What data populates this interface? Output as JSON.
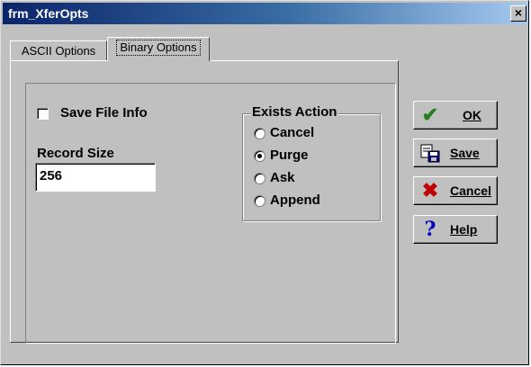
{
  "window": {
    "title": "frm_XferOpts",
    "close_glyph": "×"
  },
  "tabs": [
    {
      "label": "ASCII Options"
    },
    {
      "label": "Binary Options",
      "selected": true
    }
  ],
  "binary_options": {
    "save_file_info": {
      "label": "Save File Info",
      "checked": false
    },
    "record_size": {
      "label": "Record Size",
      "value": "256"
    },
    "exists_action": {
      "title": "Exists Action",
      "options": [
        {
          "label": "Cancel",
          "selected": false
        },
        {
          "label": "Purge",
          "selected": true
        },
        {
          "label": "Ask",
          "selected": false
        },
        {
          "label": "Append",
          "selected": false
        }
      ]
    }
  },
  "buttons": {
    "ok": {
      "label": "OK",
      "icon": "checkmark-icon"
    },
    "save": {
      "label": "Save",
      "icon": "save-icon"
    },
    "cancel": {
      "label": "Cancel",
      "icon": "x-icon"
    },
    "help": {
      "label": "Help",
      "icon": "question-icon"
    }
  },
  "colors": {
    "title_gradient_start": "#0a246a",
    "face": "#c0c0c0"
  }
}
